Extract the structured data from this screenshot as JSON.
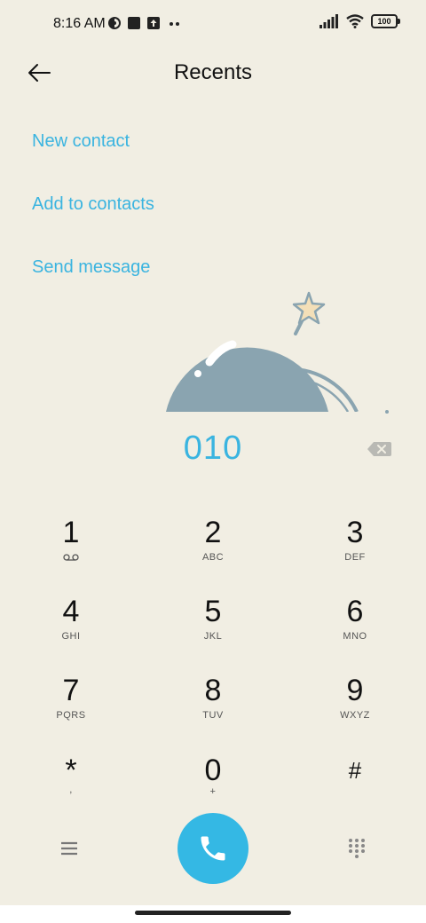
{
  "status_bar": {
    "time": "8:16 AM",
    "battery": "100",
    "icons": [
      "app-indicator-icon",
      "square-notification-icon",
      "upload-icon",
      "more-dots-icon",
      "signal-icon",
      "wifi-icon",
      "battery-icon"
    ]
  },
  "header": {
    "title": "Recents",
    "back_icon": "arrow-left-icon"
  },
  "actions": {
    "new_contact": "New contact",
    "add_to_contacts": "Add to contacts",
    "send_message": "Send message"
  },
  "dialer": {
    "number": "010",
    "delete_icon": "backspace-icon"
  },
  "keys": [
    {
      "digit": "1",
      "letters": ""
    },
    {
      "digit": "2",
      "letters": "ABC"
    },
    {
      "digit": "3",
      "letters": "DEF"
    },
    {
      "digit": "4",
      "letters": "GHI"
    },
    {
      "digit": "5",
      "letters": "JKL"
    },
    {
      "digit": "6",
      "letters": "MNO"
    },
    {
      "digit": "7",
      "letters": "PQRS"
    },
    {
      "digit": "8",
      "letters": "TUV"
    },
    {
      "digit": "9",
      "letters": "WXYZ"
    },
    {
      "digit": "*",
      "letters": ","
    },
    {
      "digit": "0",
      "letters": "+"
    },
    {
      "digit": "#",
      "letters": ""
    }
  ],
  "bottom_bar": {
    "menu_icon": "menu-icon",
    "call_icon": "phone-icon",
    "dialpad_icon": "dialpad-icon"
  },
  "colors": {
    "accent": "#3ab4e0",
    "call_button": "#34b8e4",
    "background": "#f1eee3"
  }
}
